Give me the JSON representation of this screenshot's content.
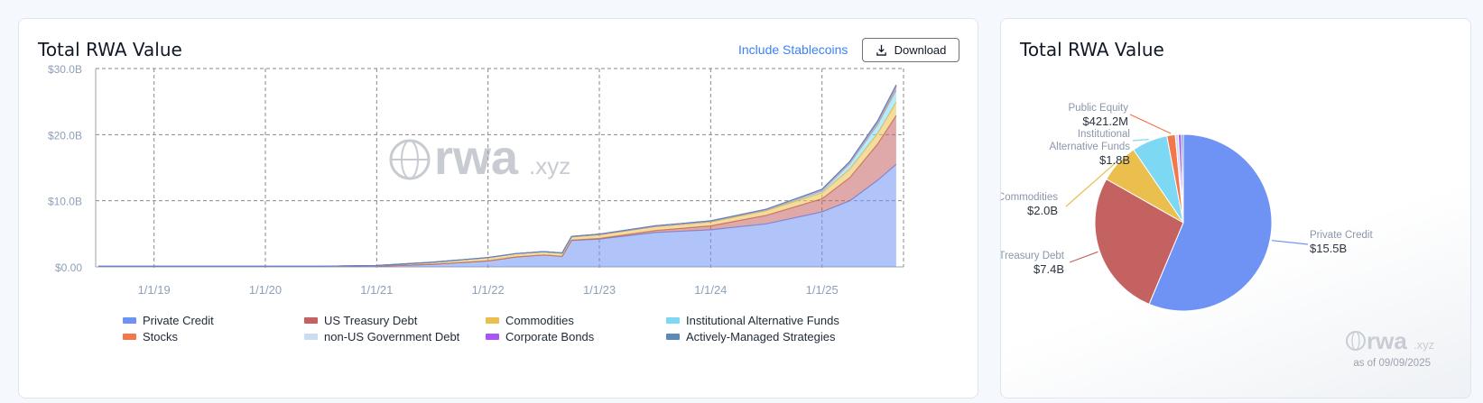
{
  "left_card": {
    "title": "Total RWA Value",
    "include_stablecoins_label": "Include Stablecoins",
    "download_label": "Download",
    "watermark": "rwa",
    "watermark_suffix": ".xyz"
  },
  "right_card": {
    "title": "Total RWA Value",
    "watermark": "rwa",
    "watermark_suffix": ".xyz",
    "as_of": "as of 09/09/2025"
  },
  "colors": {
    "private_credit": "#6f93f5",
    "us_treasury": "#c46262",
    "commodities": "#eabf4e",
    "institutional_alt": "#7dd8f3",
    "stocks": "#f2784b",
    "non_us_gov": "#c9dcf2",
    "corporate_bonds": "#a855f7",
    "actively_managed": "#5b8ab8",
    "public_equity": "#f5a97a"
  },
  "chart_data": [
    {
      "type": "area",
      "stacked": true,
      "title": "",
      "xlabel": "",
      "ylabel": "",
      "x_ticks": [
        "1/1/19",
        "1/1/20",
        "1/1/21",
        "1/1/22",
        "1/1/23",
        "1/1/24",
        "1/1/25"
      ],
      "y_ticks": [
        "$0.00",
        "$10.0B",
        "$20.0B",
        "$30.0B"
      ],
      "ylim": [
        0,
        30
      ],
      "y_unit": "billions USD",
      "grid": true,
      "legend_position": "bottom",
      "x": [
        "2018-07",
        "2019-01",
        "2019-07",
        "2020-01",
        "2020-07",
        "2021-01",
        "2021-07",
        "2022-01",
        "2022-04",
        "2022-07",
        "2022-09",
        "2022-10",
        "2023-01",
        "2023-07",
        "2024-01",
        "2024-07",
        "2025-01",
        "2025-04",
        "2025-07",
        "2025-09"
      ],
      "series": [
        {
          "name": "Private Credit",
          "color_key": "private_credit",
          "values": [
            0.1,
            0.1,
            0.1,
            0.1,
            0.1,
            0.1,
            0.4,
            0.9,
            1.5,
            1.8,
            1.6,
            4.0,
            4.2,
            5.2,
            5.6,
            6.5,
            8.3,
            10.0,
            13.1,
            15.5
          ]
        },
        {
          "name": "US Treasury Debt",
          "color_key": "us_treasury",
          "values": [
            0,
            0,
            0,
            0,
            0,
            0,
            0,
            0,
            0,
            0,
            0,
            0.05,
            0.1,
            0.3,
            0.6,
            1.3,
            2.0,
            3.5,
            5.5,
            7.4
          ]
        },
        {
          "name": "Commodities",
          "color_key": "commodities",
          "values": [
            0,
            0,
            0,
            0,
            0,
            0.1,
            0.3,
            0.5,
            0.5,
            0.5,
            0.5,
            0.5,
            0.6,
            0.6,
            0.6,
            0.7,
            0.9,
            1.3,
            1.6,
            2.0
          ]
        },
        {
          "name": "Institutional Alternative Funds",
          "color_key": "institutional_alt",
          "values": [
            0,
            0,
            0,
            0,
            0,
            0,
            0,
            0,
            0,
            0,
            0,
            0,
            0,
            0,
            0.05,
            0.1,
            0.3,
            0.8,
            1.3,
            1.8
          ]
        },
        {
          "name": "Stocks",
          "color_key": "stocks",
          "values": [
            0,
            0,
            0,
            0,
            0,
            0,
            0,
            0,
            0,
            0,
            0,
            0,
            0,
            0,
            0,
            0.02,
            0.05,
            0.1,
            0.3,
            0.42
          ]
        },
        {
          "name": "non-US Government Debt",
          "color_key": "non_us_gov",
          "values": [
            0,
            0,
            0,
            0,
            0,
            0,
            0,
            0,
            0,
            0,
            0,
            0.05,
            0.05,
            0.05,
            0.05,
            0.05,
            0.08,
            0.1,
            0.12,
            0.15
          ]
        },
        {
          "name": "Corporate Bonds",
          "color_key": "corporate_bonds",
          "values": [
            0,
            0,
            0,
            0,
            0,
            0,
            0,
            0,
            0,
            0,
            0,
            0,
            0,
            0.05,
            0.05,
            0.05,
            0.08,
            0.1,
            0.12,
            0.15
          ]
        },
        {
          "name": "Actively-Managed Strategies",
          "color_key": "actively_managed",
          "values": [
            0,
            0,
            0,
            0,
            0,
            0,
            0,
            0,
            0,
            0,
            0,
            0,
            0,
            0,
            0,
            0,
            0.03,
            0.05,
            0.08,
            0.1
          ]
        }
      ]
    },
    {
      "type": "pie",
      "title": "",
      "slices": [
        {
          "label": "Private Credit",
          "value_label": "$15.5B",
          "value": 15.5,
          "color_key": "private_credit"
        },
        {
          "label": "US Treasury Debt",
          "value_label": "$7.4B",
          "value": 7.4,
          "color_key": "us_treasury"
        },
        {
          "label": "Commodities",
          "value_label": "$2.0B",
          "value": 2.0,
          "color_key": "commodities"
        },
        {
          "label": "Institutional Alternative Funds",
          "value_label": "$1.8B",
          "value": 1.8,
          "color_key": "institutional_alt"
        },
        {
          "label": "Public Equity",
          "value_label": "$421.2M",
          "value": 0.4212,
          "color_key": "stocks"
        },
        {
          "label": "",
          "value_label": "",
          "value": 0.15,
          "color_key": "non_us_gov"
        },
        {
          "label": "",
          "value_label": "",
          "value": 0.15,
          "color_key": "corporate_bonds"
        },
        {
          "label": "",
          "value_label": "",
          "value": 0.1,
          "color_key": "actively_managed"
        }
      ]
    }
  ]
}
